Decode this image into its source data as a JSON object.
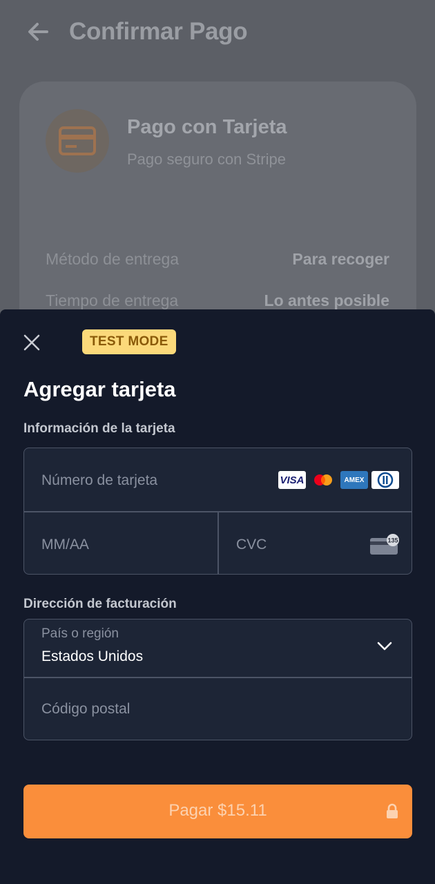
{
  "header": {
    "title": "Confirmar Pago"
  },
  "payment_card": {
    "title": "Pago con Tarjeta",
    "subtitle": "Pago seguro con Stripe",
    "rows": [
      {
        "label": "Método de entrega",
        "value": "Para recoger"
      },
      {
        "label": "Tiempo de entrega",
        "value": "Lo antes posible"
      }
    ]
  },
  "sheet": {
    "badge": "TEST MODE",
    "title": "Agregar tarjeta",
    "card_section_label": "Información de la tarjeta",
    "card_number_placeholder": "Número de tarjeta",
    "expiry_placeholder": "MM/AA",
    "cvc_placeholder": "CVC",
    "cvc_icon_text": "135",
    "brands": [
      "VISA",
      "Mastercard",
      "AMEX",
      "Diners"
    ],
    "billing_section_label": "Dirección de facturación",
    "country_label": "País o región",
    "country_value": "Estados Unidos",
    "postal_placeholder": "Código postal",
    "pay_button_label": "Pagar $15.11"
  },
  "colors": {
    "accent": "#fa8e3b",
    "sheet_bg": "#141a2a",
    "badge_bg": "#fbd97a"
  },
  "icons": [
    "back-arrow-icon",
    "credit-card-icon",
    "close-icon",
    "chevron-down-icon",
    "lock-icon",
    "cvc-card-icon"
  ]
}
